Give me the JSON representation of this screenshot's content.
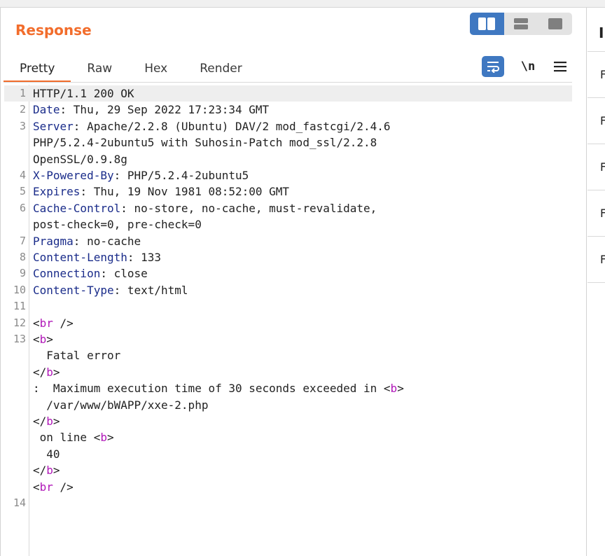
{
  "panel": {
    "title": "Response"
  },
  "tabs": [
    {
      "label": "Pretty",
      "active": true
    },
    {
      "label": "Raw",
      "active": false
    },
    {
      "label": "Hex",
      "active": false
    },
    {
      "label": "Render",
      "active": false
    }
  ],
  "toolbar": {
    "layout_options": [
      "layout-split-vertical-icon",
      "layout-split-horizontal-icon",
      "layout-single-icon"
    ],
    "wrap_icon": "wrap-lines-icon",
    "newline_label": "\\n",
    "menu_icon": "hamburger-menu-icon"
  },
  "colors": {
    "accent": "#f26d2c",
    "button_blue": "#3f78c1",
    "header_name": "#1a2c8a",
    "tag": "#b017b8"
  },
  "lines": [
    {
      "n": "1",
      "name": "",
      "text": "HTTP/1.1 200 OK"
    },
    {
      "n": "2",
      "name": "Date",
      "text": ": Thu, 29 Sep 2022 17:23:34 GMT"
    },
    {
      "n": "3",
      "name": "Server",
      "text": ": Apache/2.2.8 (Ubuntu) DAV/2 mod_fastcgi/2.4.6"
    },
    {
      "n": "",
      "name": "",
      "text": "PHP/5.2.4-2ubuntu5 with Suhosin-Patch mod_ssl/2.2.8"
    },
    {
      "n": "",
      "name": "",
      "text": "OpenSSL/0.9.8g"
    },
    {
      "n": "4",
      "name": "X-Powered-By",
      "text": ": PHP/5.2.4-2ubuntu5"
    },
    {
      "n": "5",
      "name": "Expires",
      "text": ": Thu, 19 Nov 1981 08:52:00 GMT"
    },
    {
      "n": "6",
      "name": "Cache-Control",
      "text": ": no-store, no-cache, must-revalidate,"
    },
    {
      "n": "",
      "name": "",
      "text": "post-check=0, pre-check=0"
    },
    {
      "n": "7",
      "name": "Pragma",
      "text": ": no-cache"
    },
    {
      "n": "8",
      "name": "Content-Length",
      "text": ": 133"
    },
    {
      "n": "9",
      "name": "Connection",
      "text": ": close"
    },
    {
      "n": "10",
      "name": "Content-Type",
      "text": ": text/html"
    },
    {
      "n": "11",
      "name": "",
      "text": ""
    },
    {
      "n": "12",
      "name": "",
      "text": "<br />"
    },
    {
      "n": "13",
      "name": "",
      "text": "<b>"
    },
    {
      "n": "",
      "name": "",
      "text": "  Fatal error"
    },
    {
      "n": "",
      "name": "",
      "text": "</b>"
    },
    {
      "n": "",
      "name": "",
      "text": ":  Maximum execution time of 30 seconds exceeded in <b>"
    },
    {
      "n": "",
      "name": "",
      "text": "  /var/www/bWAPP/xxe-2.php"
    },
    {
      "n": "",
      "name": "",
      "text": "</b>"
    },
    {
      "n": "",
      "name": "",
      "text": " on line <b>"
    },
    {
      "n": "",
      "name": "",
      "text": "  40"
    },
    {
      "n": "",
      "name": "",
      "text": "</b>"
    },
    {
      "n": "",
      "name": "",
      "text": "<br />"
    },
    {
      "n": "14",
      "name": "",
      "text": ""
    }
  ],
  "side_panel": {
    "title": "I",
    "rows": [
      "F",
      "F",
      "F",
      "F",
      "F"
    ]
  }
}
